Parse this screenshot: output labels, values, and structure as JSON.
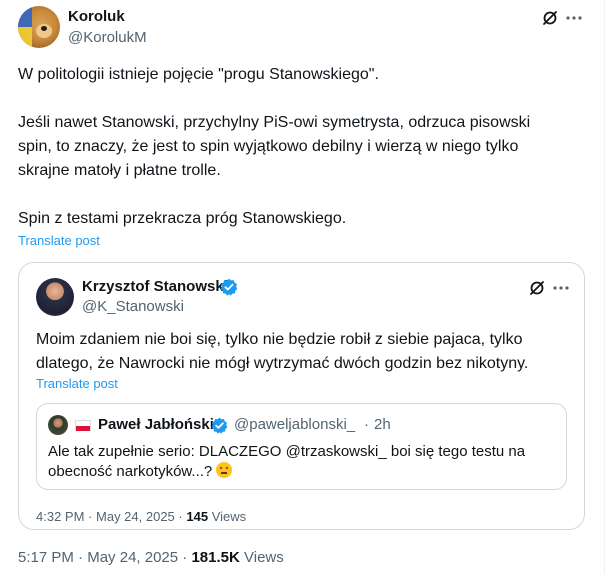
{
  "tweet": {
    "author_name": "Koroluk",
    "author_handle": "@KorolukM",
    "paragraph_1": "W politologii istnieje pojęcie \"progu Stanowskiego\".",
    "paragraph_2_line_1": "Jeśli nawet Stanowski, przychylny PiS-owi symetrysta, odrzuca pisowski",
    "paragraph_2_line_2": "spin, to znaczy, że jest to spin wyjątkowo debilny i wierzą w niego tylko",
    "paragraph_2_line_3": "skrajne matoły i płatne trolle.",
    "paragraph_3": "Spin z testami przekracza próg Stanowskiego.",
    "translate_label": "Translate post",
    "time": "5:17 PM",
    "separator": "·",
    "date": "May 24, 2025",
    "views_count": "181.5K",
    "views_label": "Views",
    "more_icon": "more-horizontal-icon",
    "grok_icon": "grok-icon"
  },
  "quoted": {
    "author_name": "Krzysztof Stanowski",
    "author_handle": "@K_Stanowski",
    "line_1": "Moim zdaniem nie boi się, tylko nie będzie robił z siebie pajaca, tylko",
    "line_2": "dlatego, że Nawrocki nie mógł wytrzymać dwóch godzin bez nikotyny.",
    "translate_label": "Translate post",
    "time": "4:32 PM",
    "separator": "·",
    "date": "May 24, 2025",
    "views_count": "145",
    "views_label": "Views",
    "verified_color": "#1d9bf0"
  },
  "nested": {
    "author_name": "Paweł Jabłoński",
    "author_handle": "@paweljablonski_",
    "separator": "·",
    "time": "2h",
    "line_1": "Ale tak zupełnie serio: DLACZEGO @trzaskowski_ boi się tego testu na",
    "line_2": "obecność narkotyków...?",
    "emoji": "thinking-face-icon"
  },
  "colors": {
    "link": "#1d9bf0",
    "secondary_text": "#536471",
    "border": "#cfd9de"
  }
}
